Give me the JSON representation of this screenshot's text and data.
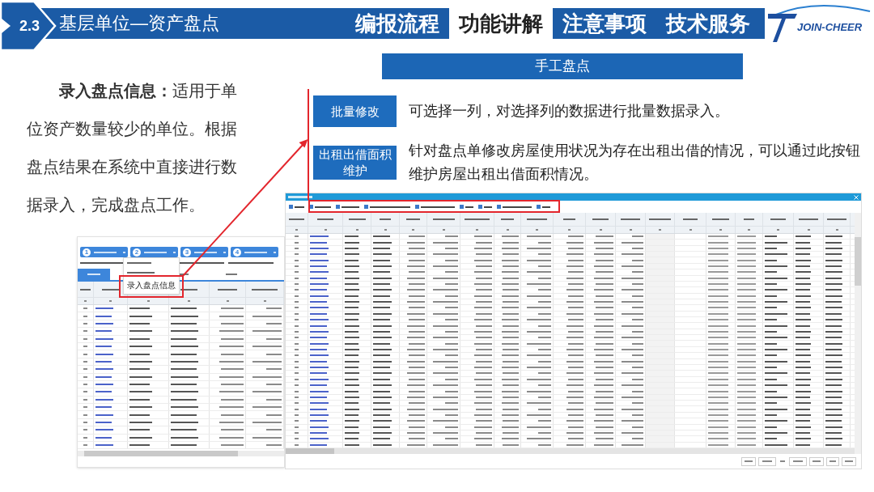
{
  "header": {
    "section": "2.3",
    "title": "基层单位—资产盘点",
    "tabs": [
      {
        "label": "编报流程",
        "selected": false
      },
      {
        "label": "功能讲解",
        "selected": true
      },
      {
        "label": "注意事项",
        "selected": false
      },
      {
        "label": "技术服务",
        "selected": false
      }
    ],
    "logo": "JOIN-CHEER"
  },
  "banner": "手工盘点",
  "intro": "**录入盘点信息：**适用于单位资产数量较少的单位。根据盘点结果在系统中直接进行数据录入，完成盘点工作。",
  "features": [
    {
      "button": "批量修改",
      "description": "可选择一列，对选择列的数据进行批量数据录入。"
    },
    {
      "button": "出租出借面积维护",
      "description": "针对盘点单修改房屋使用状况为存在出租出借的情况，可以通过此按钮维护房屋出租出借面积情况。"
    }
  ],
  "left_screenshot": {
    "steps": [
      {
        "number": "1"
      },
      {
        "number": "2"
      },
      {
        "number": "3"
      },
      {
        "number": "4"
      }
    ],
    "menu_item": "录入盘点信息"
  }
}
